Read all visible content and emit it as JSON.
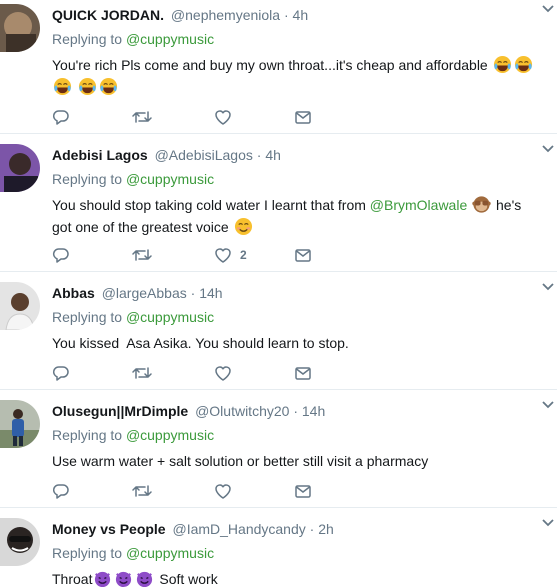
{
  "tweets": [
    {
      "name": "QUICK JORDAN.",
      "handle": "@nephemyeniola",
      "dot": "·",
      "time": "4h",
      "replying_label": "Replying to",
      "replying_to": "@cuppymusic",
      "text": "You're rich Pls come and buy my own throat...it's cheap and affordable",
      "emoji": "😂",
      "like_count": ""
    },
    {
      "name": "Adebisi Lagos",
      "handle": "@AdebisiLagos",
      "dot": "·",
      "time": "4h",
      "replying_label": "Replying to",
      "replying_to": "@cuppymusic",
      "text_before": "You should stop taking cold water I learnt that from",
      "mention": "@BrymOlawale",
      "emoji_a": "🙈",
      "text_after": "he's got one of the greatest voice",
      "emoji_b": "😊",
      "like_count": "2"
    },
    {
      "name": "Abbas",
      "handle": "@largeAbbas",
      "dot": "·",
      "time": "14h",
      "replying_label": "Replying to",
      "replying_to": "@cuppymusic",
      "text": "You kissed  Asa Asika. You should learn to stop.",
      "like_count": ""
    },
    {
      "name": "Olusegun||MrDimple",
      "handle": "@Olutwitchy20",
      "dot": "·",
      "time": "14h",
      "replying_label": "Replying to",
      "replying_to": "@cuppymusic",
      "text": "Use warm water + salt solution or better still visit a pharmacy",
      "like_count": ""
    },
    {
      "name": "Money vs People",
      "handle": "@IamD_Handycandy",
      "dot": "·",
      "time": "2h",
      "replying_label": "Replying to",
      "replying_to": "@cuppymusic",
      "text_before": "Throat",
      "emoji": "😈",
      "text_after": "Soft work"
    }
  ],
  "icons": {
    "reply": "reply-icon",
    "retweet": "retweet-icon",
    "like": "heart-icon",
    "dm": "envelope-icon",
    "chevron": "chevron-down-icon"
  },
  "colors": {
    "link": "#3b9a3b",
    "muted": "#657786",
    "text": "#14171a",
    "divider": "#e6ecf0"
  }
}
